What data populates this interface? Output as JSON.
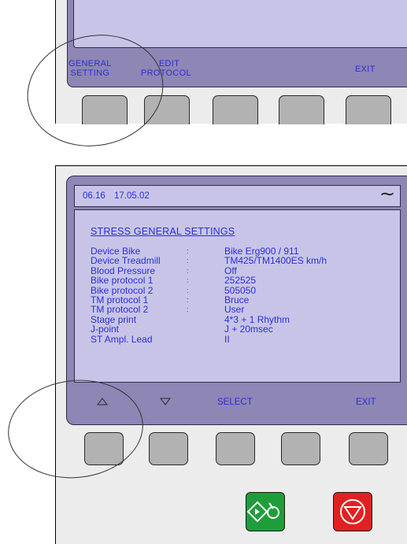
{
  "top_panel": {
    "softkeys": {
      "general_line1": "GENERAL",
      "general_line2": "SETTING",
      "edit_line1": "EDIT",
      "edit_line2": "PROTOCOL",
      "exit": "EXIT"
    }
  },
  "bottom_panel": {
    "header": {
      "time": "06.16",
      "date": "17.05.02",
      "signal_glyph": "∼"
    },
    "screen": {
      "title": "STRESS GENERAL SETTINGS",
      "separator": ":",
      "settings": [
        {
          "label": "Device Bike",
          "value": "Bike Erg900 / 911"
        },
        {
          "label": "Device Treadmill",
          "value": "TM425/TM1400ES km/h"
        },
        {
          "label": "Blood Pressure",
          "value": "Off"
        },
        {
          "label": "Bike protocol 1",
          "value": "252525"
        },
        {
          "label": "Bike protocol 2",
          "value": "505050"
        },
        {
          "label": "TM protocol 1",
          "value": "Bruce"
        },
        {
          "label": "TM protocol 2",
          "value": "User"
        },
        {
          "label": "Stage print",
          "value": "4*3 + 1 Rhythm"
        },
        {
          "label": "J-point",
          "value": "J + 20msec"
        },
        {
          "label": "ST Ampl. Lead",
          "value": "II"
        }
      ]
    },
    "softkeys": {
      "up_icon": "triangle-up-icon",
      "down_icon": "triangle-down-icon",
      "select": "SELECT",
      "exit": "EXIT"
    },
    "start_button_icon": "start-icon",
    "stop_button_icon": "stop-icon"
  },
  "colors": {
    "screen": "#c8c4e8",
    "bezel": "#8e86b4",
    "text": "#2b2fd6",
    "start": "#1e9e3a",
    "stop": "#e02121"
  }
}
